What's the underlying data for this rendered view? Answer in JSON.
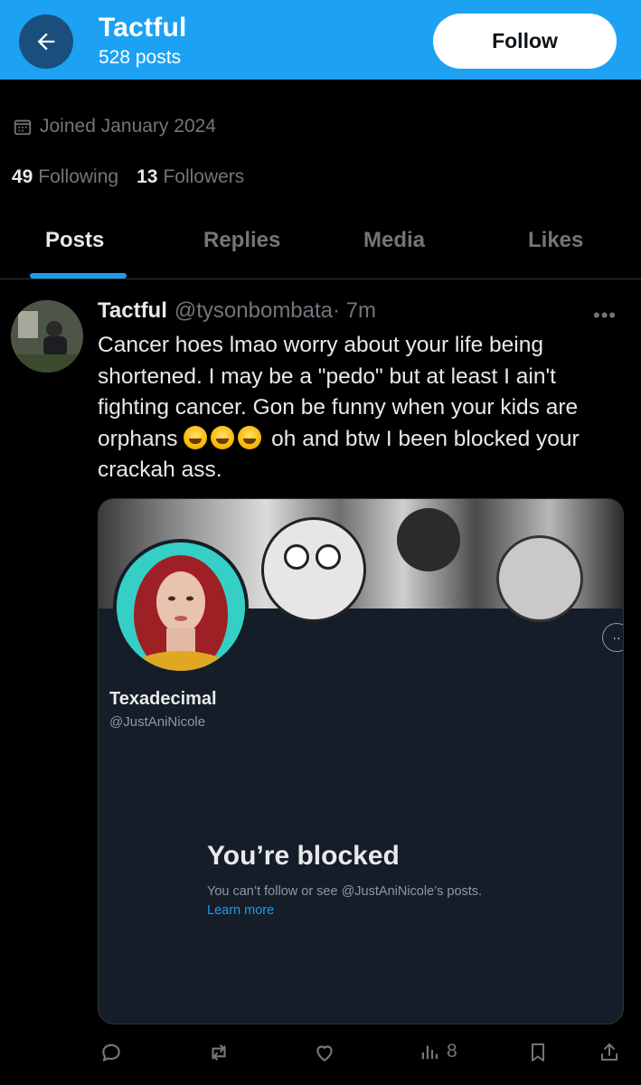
{
  "header": {
    "back_icon": "arrow-left-icon",
    "title": "Tactful",
    "posts_count": "528 posts",
    "follow_label": "Follow",
    "background": "#1da1f2"
  },
  "profile": {
    "joined": "Joined January 2024",
    "following_count": "49",
    "following_label": "Following",
    "followers_count": "13",
    "followers_label": "Followers"
  },
  "tabs": [
    {
      "label": "Posts",
      "active": true
    },
    {
      "label": "Replies",
      "active": false
    },
    {
      "label": "Media",
      "active": false
    },
    {
      "label": "Likes",
      "active": false
    }
  ],
  "post": {
    "author_name": "Tactful",
    "author_handle": "@tysonbombata",
    "time": "· 7m",
    "text_part1": "Cancer hoes lmao worry about your life being shortened. I may be a \"pedo\" but at least I ain't fighting cancer. Gon be funny when your kids are orphans",
    "emoji": "😂😂😂",
    "text_part2": "oh and btw I been blocked your crackah ass.",
    "embed": {
      "display_name": "Texadecimal",
      "handle": "@JustAniNicole",
      "blocked_title": "You’re blocked",
      "blocked_desc": "You can’t follow or see @JustAniNicole’s posts.",
      "learn_more": "Learn more"
    },
    "actions": {
      "reply_icon": "reply-icon",
      "repost_icon": "repost-icon",
      "like_icon": "heart-icon",
      "views_icon": "views-icon",
      "views_count": "8",
      "bookmark_icon": "bookmark-icon",
      "share_icon": "share-icon"
    }
  }
}
